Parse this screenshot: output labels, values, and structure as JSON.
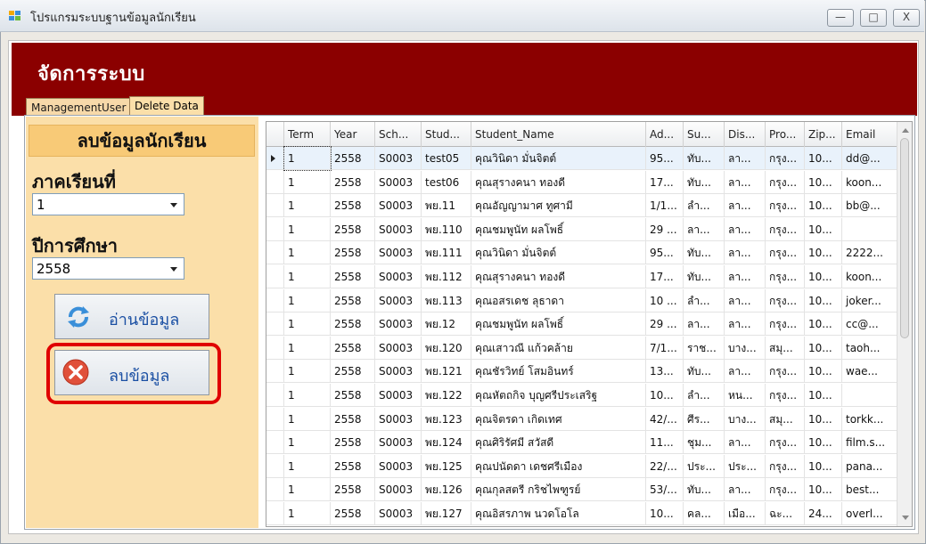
{
  "window": {
    "title": "โปรแกรมระบบฐานข้อมูลนักเรียน",
    "controls": {
      "minimize": "—",
      "maximize": "□",
      "close": "X"
    }
  },
  "header": {
    "title": "จัดการระบบ"
  },
  "tabs": [
    {
      "label": "ManagementUser"
    },
    {
      "label": "Delete Data"
    }
  ],
  "left_panel": {
    "heading": "ลบข้อมูลนักเรียน",
    "term_label": "ภาคเรียนที่",
    "term_value": "1",
    "year_label": "ปีการศึกษา",
    "year_value": "2558",
    "read_button": "อ่านข้อมูล",
    "delete_button": "ลบข้อมูล"
  },
  "grid": {
    "columns": [
      "Term",
      "Year",
      "Sch...",
      "Stud...",
      "Student_Name",
      "Ad...",
      "Su...",
      "Dis...",
      "Pro...",
      "Zip...",
      "Email"
    ],
    "rows": [
      [
        "1",
        "2558",
        "S0003",
        "test05",
        "คุณวินิดา มั่นจิตต์",
        "95...",
        "ทับ...",
        "ลา...",
        "กรุง...",
        "10...",
        "dd@..."
      ],
      [
        "1",
        "2558",
        "S0003",
        "test06",
        "คุณสุรางคนา ทองดี",
        "17...",
        "ทับ...",
        "ลา...",
        "กรุง...",
        "10...",
        "koon..."
      ],
      [
        "1",
        "2558",
        "S0003",
        "พย.11",
        "คุณอัญญามาศ ทูศามี",
        "1/1...",
        "ลำ...",
        "ลา...",
        "กรุง...",
        "10...",
        "bb@..."
      ],
      [
        "1",
        "2558",
        "S0003",
        "พย.110",
        "คุณชมพูนัท ผลโพธิ์",
        "29 ...",
        "ลา...",
        "ลา...",
        "กรุง...",
        "10...",
        ""
      ],
      [
        "1",
        "2558",
        "S0003",
        "พย.111",
        "คุณวินิดา มั่นจิตต์",
        "95...",
        "ทับ...",
        "ลา...",
        "กรุง...",
        "10...",
        "2222..."
      ],
      [
        "1",
        "2558",
        "S0003",
        "พย.112",
        "คุณสุรางคนา ทองดี",
        "17...",
        "ทับ...",
        "ลา...",
        "กรุง...",
        "10...",
        "koon..."
      ],
      [
        "1",
        "2558",
        "S0003",
        "พย.113",
        "คุณอสรเดช ลุธาดา",
        "10 ...",
        "ลำ...",
        "ลา...",
        "กรุง...",
        "10...",
        "joker..."
      ],
      [
        "1",
        "2558",
        "S0003",
        "พย.12",
        "คุณชมพูนัท ผลโพธิ์",
        "29 ...",
        "ลา...",
        "ลา...",
        "กรุง...",
        "10...",
        "cc@..."
      ],
      [
        "1",
        "2558",
        "S0003",
        "พย.120",
        "คุณเสาวณี แก้วคล้าย",
        "7/1...",
        "ราช...",
        "บาง...",
        "สมุ...",
        "10...",
        "taoh..."
      ],
      [
        "1",
        "2558",
        "S0003",
        "พย.121",
        "คุณชัรวิทย์ โสมอินทร์",
        "13...",
        "ทับ...",
        "ลา...",
        "กรุง...",
        "10...",
        "wae..."
      ],
      [
        "1",
        "2558",
        "S0003",
        "พย.122",
        "คุณหัตถกิจ บุญศรีประเสริฐ",
        "10...",
        "ลำ...",
        "หน...",
        "กรุง...",
        "10...",
        ""
      ],
      [
        "1",
        "2558",
        "S0003",
        "พย.123",
        "คุณจิตรดา เกิดเทศ",
        "42/...",
        "ศีร...",
        "บาง...",
        "สมุ...",
        "10...",
        "torkk..."
      ],
      [
        "1",
        "2558",
        "S0003",
        "พย.124",
        "คุณศิริรัศมี สวัสดี",
        "11...",
        "ชุม...",
        "ลา...",
        "กรุง...",
        "10...",
        "film.s..."
      ],
      [
        "1",
        "2558",
        "S0003",
        "พย.125",
        "คุณปนัดดา เดชศรีเมือง",
        "22/...",
        "ประ...",
        "ประ...",
        "กรุง...",
        "10...",
        "pana..."
      ],
      [
        "1",
        "2558",
        "S0003",
        "พย.126",
        "คุณกุลสตรี กริชไพฑูรย์",
        "53/...",
        "ทับ...",
        "ลา...",
        "กรุง...",
        "10...",
        "best..."
      ],
      [
        "1",
        "2558",
        "S0003",
        "พย.127",
        "คุณอิสรภาพ นวดโอโล",
        "10...",
        "คล...",
        "เมือ...",
        "ฉะ...",
        "24...",
        "overl..."
      ]
    ]
  }
}
